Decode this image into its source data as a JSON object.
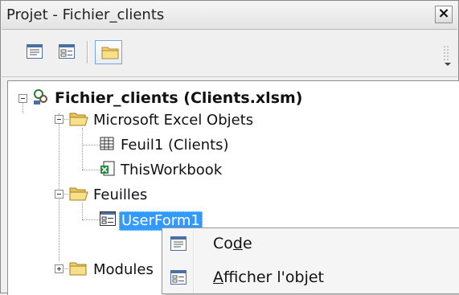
{
  "window": {
    "title": "Projet - Fichier_clients",
    "close_glyph": "×"
  },
  "toolbar": {
    "buttons": [
      {
        "icon": "view-code-icon"
      },
      {
        "icon": "view-object-icon"
      },
      {
        "icon": "toggle-folders-icon",
        "active": true
      }
    ]
  },
  "tree": {
    "project_label": "Fichier_clients (Clients.xlsm)",
    "folders": [
      {
        "label": "Microsoft Excel Objets",
        "children": [
          "Feuil1 (Clients)",
          "ThisWorkbook"
        ]
      },
      {
        "label": "Feuilles",
        "children": [
          "UserForm1"
        ]
      },
      {
        "label": "Modules",
        "collapsed": true
      }
    ],
    "selected": "UserForm1"
  },
  "context_menu": {
    "items": [
      {
        "label_pre": "Co",
        "accel": "d",
        "label_post": "e",
        "icon": "code-icon"
      },
      {
        "label_pre": "",
        "accel": "A",
        "label_post": "fficher l'objet",
        "icon": "form-icon"
      }
    ]
  },
  "colors": {
    "selection": "#3399ff",
    "folder": "#f4d26b"
  }
}
